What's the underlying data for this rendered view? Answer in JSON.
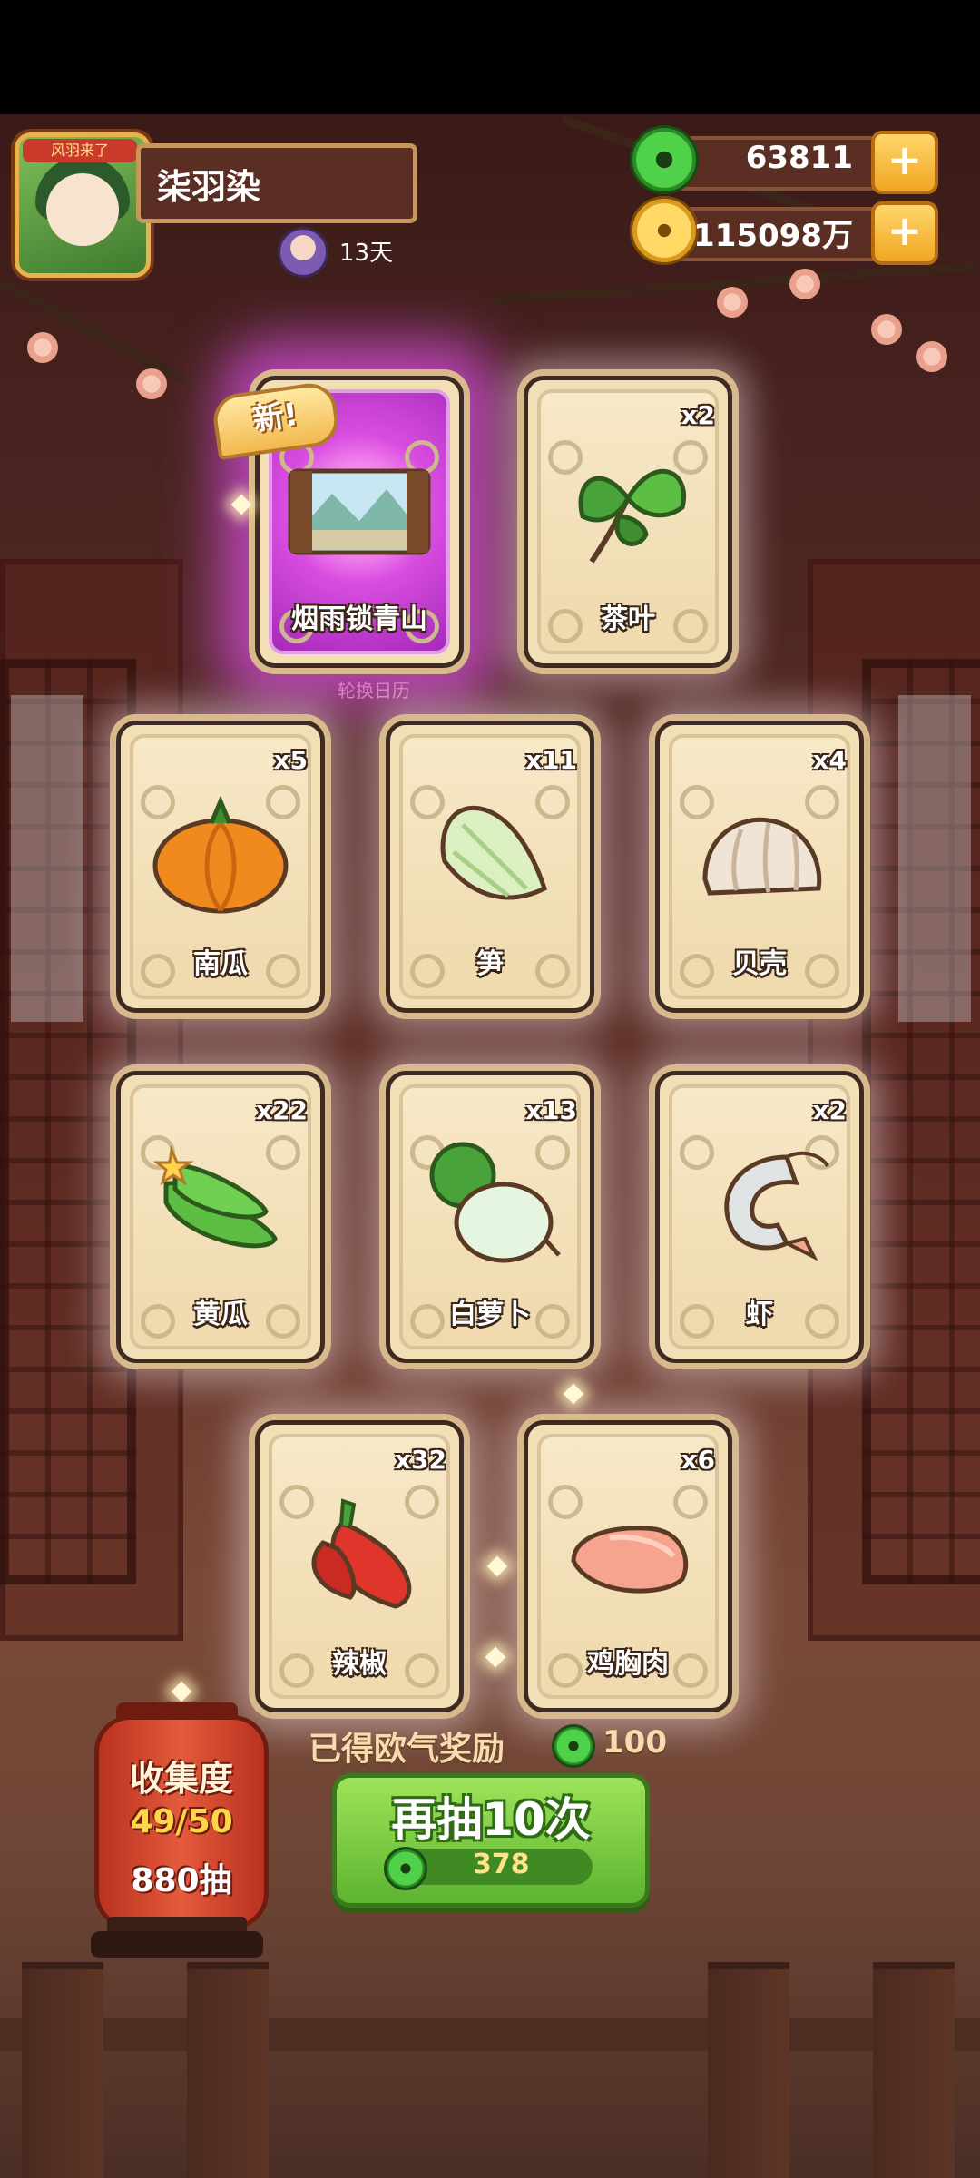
{
  "player": {
    "name": "柒羽染",
    "days": "13天",
    "avatar_banner": "风羽来了"
  },
  "currencies": [
    {
      "name": "jade-coin",
      "amount": "63811",
      "add_label": "+",
      "color": "#4fd14a"
    },
    {
      "name": "gold-coin",
      "amount": "115098万",
      "add_label": "+",
      "color": "#ffd866"
    }
  ],
  "new_badge": "新!",
  "calendar_label": "轮换日历",
  "cards": [
    {
      "label": "烟雨锁青山",
      "count": "",
      "icon": "scenery-icon",
      "special": true
    },
    {
      "label": "茶叶",
      "count": "x2",
      "icon": "tea-leaf-icon"
    },
    {
      "label": "南瓜",
      "count": "x5",
      "icon": "pumpkin-icon"
    },
    {
      "label": "笋",
      "count": "x11",
      "icon": "bamboo-shoot-icon"
    },
    {
      "label": "贝壳",
      "count": "x4",
      "icon": "clam-icon"
    },
    {
      "label": "黄瓜",
      "count": "x22",
      "icon": "cucumber-icon"
    },
    {
      "label": "白萝卜",
      "count": "x13",
      "icon": "radish-icon"
    },
    {
      "label": "虾",
      "count": "x2",
      "icon": "shrimp-icon"
    },
    {
      "label": "辣椒",
      "count": "x32",
      "icon": "chili-icon"
    },
    {
      "label": "鸡胸肉",
      "count": "x6",
      "icon": "chicken-breast-icon"
    }
  ],
  "reward": {
    "text": "已得欧气奖励",
    "amount": "100"
  },
  "draw_button": {
    "label": "再抽10次",
    "cost": "378"
  },
  "collection": {
    "title": "收集度",
    "progress": "49/50",
    "draws": "880抽"
  },
  "colors": {
    "accent_green": "#5cb42f",
    "lantern_red": "#e55a3b",
    "card_bg": "#f3dfb6"
  }
}
